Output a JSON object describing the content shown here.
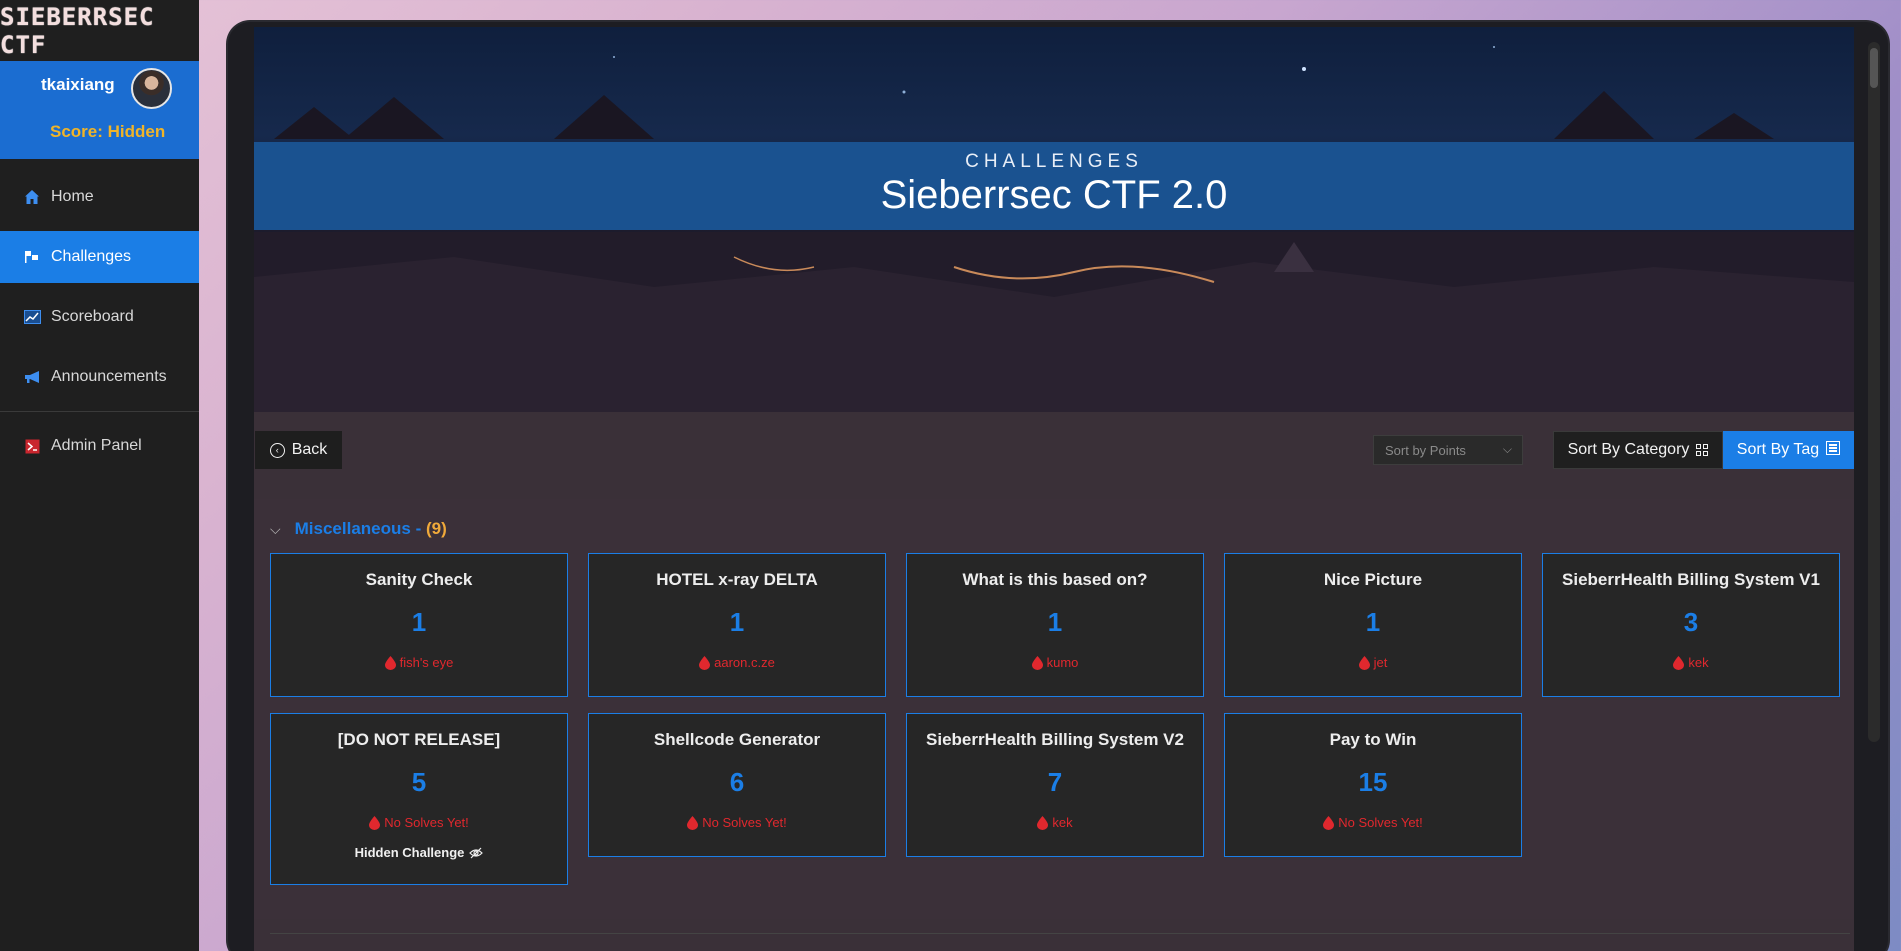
{
  "app": {
    "logo_text": "SIEBERRSEC CTF"
  },
  "user": {
    "name": "tkaixiang",
    "score_label": "Score:",
    "score_value": "Hidden"
  },
  "nav": {
    "items": [
      {
        "label": "Home",
        "icon": "home-icon",
        "active": false
      },
      {
        "label": "Challenges",
        "icon": "flag-icon",
        "active": true
      },
      {
        "label": "Scoreboard",
        "icon": "chart-icon",
        "active": false
      },
      {
        "label": "Announcements",
        "icon": "megaphone-icon",
        "active": false
      },
      {
        "label": "Admin Panel",
        "icon": "terminal-icon",
        "active": false
      }
    ]
  },
  "banner": {
    "subtitle": "CHALLENGES",
    "title": "Sieberrsec CTF 2.0"
  },
  "toolbar": {
    "back_label": "Back",
    "sort_placeholder": "Sort by Points",
    "sort_by_category_label": "Sort By Category",
    "sort_by_tag_label": "Sort By Tag"
  },
  "category": {
    "name": "Miscellaneous",
    "separator": " - ",
    "count": "(9)"
  },
  "challenges": [
    {
      "title": "Sanity Check",
      "points": "1",
      "first_blood": "fish's eye"
    },
    {
      "title": "HOTEL x-ray DELTA",
      "points": "1",
      "first_blood": "aaron.c.ze"
    },
    {
      "title": "What is this based on?",
      "points": "1",
      "first_blood": "kumo"
    },
    {
      "title": "Nice Picture",
      "points": "1",
      "first_blood": "jet"
    },
    {
      "title": "SieberrHealth Billing System V1",
      "points": "3",
      "first_blood": "kek"
    },
    {
      "title": "[DO NOT RELEASE]",
      "points": "5",
      "first_blood": "No Solves Yet!",
      "hidden_label": "Hidden Challenge"
    },
    {
      "title": "Shellcode Generator",
      "points": "6",
      "first_blood": "No Solves Yet!"
    },
    {
      "title": "SieberrHealth Billing System V2",
      "points": "7",
      "first_blood": "kek"
    },
    {
      "title": "Pay to Win",
      "points": "15",
      "first_blood": "No Solves Yet!"
    }
  ],
  "colors": {
    "accent": "#1b7ee6",
    "score": "#f0b429",
    "first_blood": "#e0282e",
    "count": "#f0a93a"
  }
}
